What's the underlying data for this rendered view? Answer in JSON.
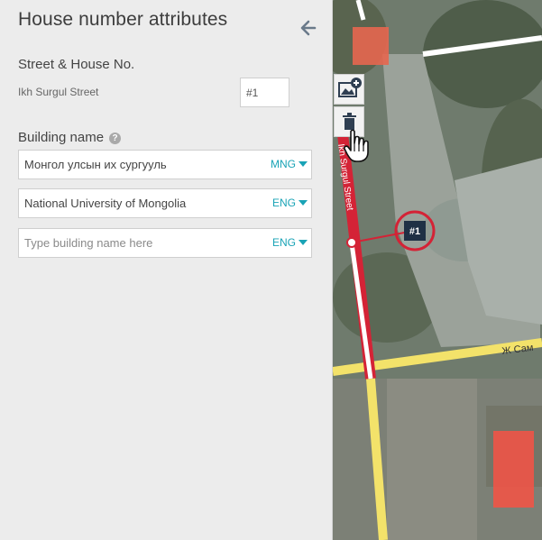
{
  "panel": {
    "title": "House number attributes",
    "back_icon": "arrow-left-icon"
  },
  "street_section": {
    "label": "Street & House No.",
    "street_name": "Ikh Surgul Street",
    "house_number": "#1"
  },
  "building_section": {
    "label": "Building name",
    "help_icon": "?",
    "rows": [
      {
        "value": "Монгол улсын их сургууль",
        "placeholder": "",
        "language": "MNG"
      },
      {
        "value": "National University of Mongolia",
        "placeholder": "",
        "language": "ENG"
      },
      {
        "value": "",
        "placeholder": "Type building name here",
        "language": "ENG"
      }
    ]
  },
  "map": {
    "street_label": "Ikh Surgul Street",
    "cross_street_label": "Ж Сам",
    "marker_label": "#1",
    "tools": [
      {
        "name": "add-photo-icon"
      },
      {
        "name": "trash-icon"
      }
    ]
  },
  "colors": {
    "accent": "#19a3b6",
    "selected_street": "#d42336",
    "road_yellow": "#f3e26a",
    "building_highlight": "#ff4d3d"
  }
}
